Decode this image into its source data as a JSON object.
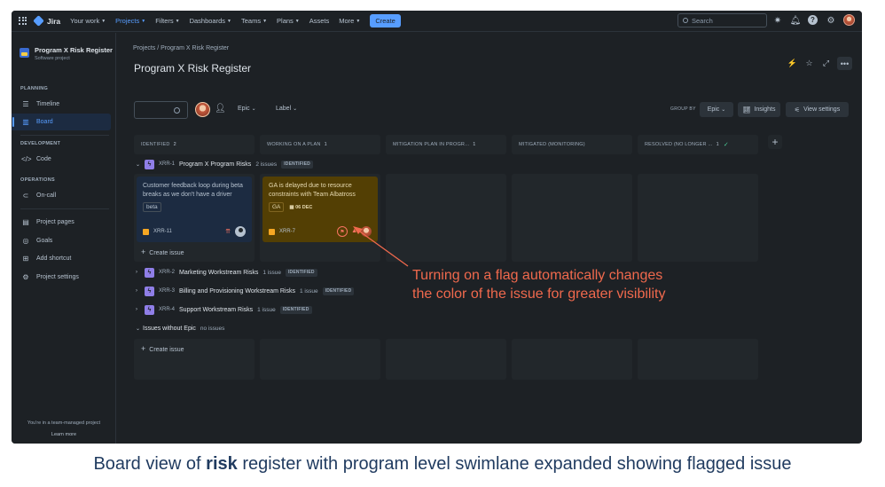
{
  "topnav": {
    "logo": "Jira",
    "items": [
      {
        "label": "Your work",
        "caret": true
      },
      {
        "label": "Projects",
        "caret": true,
        "active": true
      },
      {
        "label": "Filters",
        "caret": true
      },
      {
        "label": "Dashboards",
        "caret": true
      },
      {
        "label": "Teams",
        "caret": true
      },
      {
        "label": "Plans",
        "caret": true
      },
      {
        "label": "Assets",
        "caret": false
      },
      {
        "label": "More",
        "caret": true
      }
    ],
    "create_label": "Create",
    "search_placeholder": "Search",
    "icons": [
      "apps-grid-icon",
      "jira-logo-icon",
      "notifications-icon",
      "help-icon",
      "settings-icon"
    ]
  },
  "sidebar": {
    "project_name": "Program X Risk Register",
    "project_type": "Software project",
    "sections": {
      "planning": "PLANNING",
      "development": "DEVELOPMENT",
      "operations": "OPERATIONS"
    },
    "items": {
      "timeline": "Timeline",
      "board": "Board",
      "code": "Code",
      "oncall": "On-call",
      "project_pages": "Project pages",
      "goals": "Goals",
      "add_shortcut": "Add shortcut",
      "project_settings": "Project settings"
    },
    "footer_text": "You're in a team-managed project",
    "learn_more": "Learn more"
  },
  "main": {
    "breadcrumb": "Projects  /  Program X Risk Register",
    "title": "Program X Risk Register",
    "toolbar": {
      "epic_filter": "Epic",
      "label_filter": "Label",
      "group_by_label": "GROUP BY",
      "group_by_value": "Epic",
      "insights": "Insights",
      "view_settings": "View settings"
    },
    "columns": [
      {
        "name": "IDENTIFIED",
        "count": "2",
        "check": false
      },
      {
        "name": "WORKING ON A PLAN",
        "count": "1",
        "check": false
      },
      {
        "name": "MITIGATION PLAN IN PROGR...",
        "count": "1",
        "check": false
      },
      {
        "name": "MITIGATED (MONITORING)",
        "count": "",
        "check": false
      },
      {
        "name": "RESOLVED (NO LONGER ...",
        "count": "1",
        "check": true
      }
    ],
    "swimlanes": [
      {
        "key": "XRR-1",
        "name": "Program X Program Risks",
        "count": "2 issues",
        "status": "IDENTIFIED",
        "expanded": true
      },
      {
        "key": "XRR-2",
        "name": "Marketing Workstream Risks",
        "count": "1 issue",
        "status": "IDENTIFIED",
        "expanded": false
      },
      {
        "key": "XRR-3",
        "name": "Billing and Provisioning Workstream Risks",
        "count": "1 issue",
        "status": "IDENTIFIED",
        "expanded": false
      },
      {
        "key": "XRR-4",
        "name": "Support Workstream Risks",
        "count": "1 issue",
        "status": "IDENTIFIED",
        "expanded": false
      }
    ],
    "no_epic": {
      "label": "Issues without Epic",
      "count": "no issues"
    },
    "cards": [
      {
        "summary": "Customer feedback loop during beta breaks as we don't have a driver",
        "label": "beta",
        "key": "XRR-11",
        "flagged": false
      },
      {
        "summary": "GA is delayed due to resource constraints with Team Albatross",
        "label": "GA",
        "due": "06 DEC",
        "key": "XRR-7",
        "flagged": true
      }
    ],
    "create_issue": "Create issue"
  },
  "annotation": {
    "line1": "Turning on a flag automatically changes",
    "line2": "the color of the issue for greater visibility",
    "color": "#f0694d"
  },
  "caption": {
    "prefix": "Board view of ",
    "bold": "risk",
    "suffix": " register with program level swimlane expanded showing flagged issue"
  },
  "colors": {
    "background": "#1d2125",
    "accent": "#579dff",
    "flagged_card": "#533f04",
    "normal_card": "#1c2b41"
  }
}
